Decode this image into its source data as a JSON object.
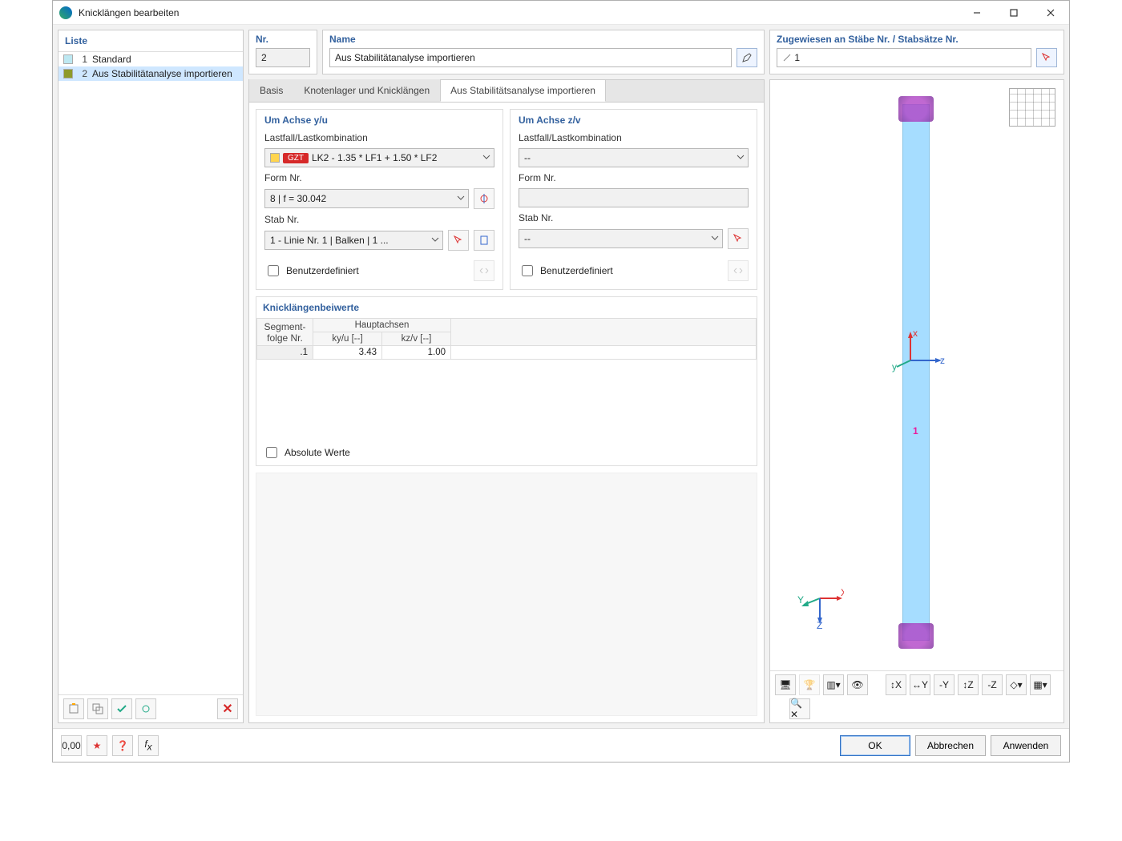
{
  "window": {
    "title": "Knicklängen bearbeiten"
  },
  "sidebar": {
    "header": "Liste",
    "items": [
      {
        "idx": "1",
        "label": "Standard",
        "color": "#bde8f2",
        "selected": false
      },
      {
        "idx": "2",
        "label": "Aus Stabilitätanalyse importieren",
        "color": "#8e9a2a",
        "selected": true
      }
    ]
  },
  "toprow": {
    "nr_label": "Nr.",
    "nr_value": "2",
    "name_label": "Name",
    "name_value": "Aus Stabilitätanalyse importieren",
    "assigned_label": "Zugewiesen an Stäbe Nr. / Stabsätze Nr.",
    "assigned_value": "1"
  },
  "tabs": {
    "items": [
      {
        "label": "Basis",
        "active": false
      },
      {
        "label": "Knotenlager und Knicklängen",
        "active": false
      },
      {
        "label": "Aus Stabilitätsanalyse importieren",
        "active": true
      }
    ]
  },
  "axis_y": {
    "title": "Um Achse y/u",
    "lc_label": "Lastfall/Lastkombination",
    "lc_tag": "GZT",
    "lc_value": "LK2 - 1.35 * LF1 + 1.50 * LF2",
    "form_label": "Form Nr.",
    "form_value": "8 | f = 30.042",
    "stab_label": "Stab Nr.",
    "stab_value": "1 - Linie Nr. 1 | Balken | 1 ...",
    "userdef": "Benutzerdefiniert"
  },
  "axis_z": {
    "title": "Um Achse z/v",
    "lc_label": "Lastfall/Lastkombination",
    "lc_value": "--",
    "form_label": "Form Nr.",
    "form_value": "",
    "stab_label": "Stab Nr.",
    "stab_value": "--",
    "userdef": "Benutzerdefiniert"
  },
  "coeff": {
    "title": "Knicklängenbeiwerte",
    "col_seg": "Segment-\nfolge Nr.",
    "col_seg1": "Segment-",
    "col_seg2": "folge Nr.",
    "col_group": "Hauptachsen",
    "col_ky": "ky/u [--]",
    "col_kz": "kz/v [--]",
    "rows": [
      {
        "seg": ".1",
        "ky": "3.43",
        "kz": "1.00"
      }
    ],
    "absolute": "Absolute Werte"
  },
  "preview": {
    "axis_x": "x",
    "axis_y": "y",
    "axis_z": "z",
    "gaxis_x": "X",
    "gaxis_y": "Y",
    "gaxis_z": "Z"
  },
  "footer": {
    "ok": "OK",
    "cancel": "Abbrechen",
    "apply": "Anwenden"
  }
}
